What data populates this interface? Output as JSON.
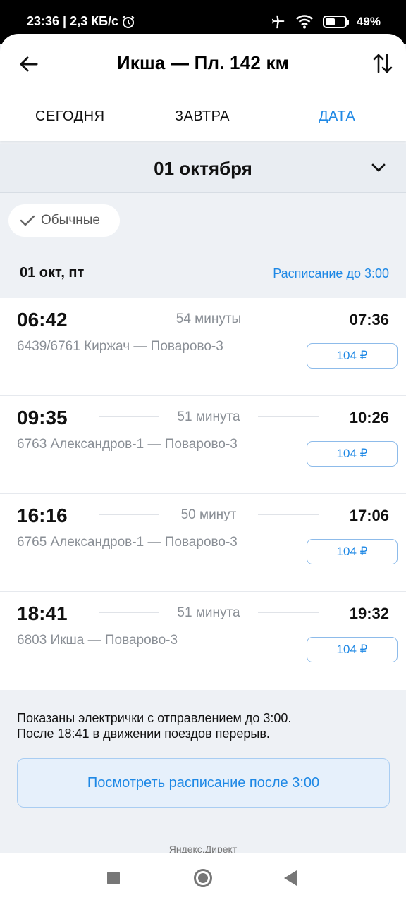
{
  "status_bar": {
    "time_speed": "23:36 | 2,3 КБ/с",
    "battery": "49%",
    "battery_level": 0.49
  },
  "header": {
    "title": "Икша — Пл. 142 км",
    "tabs": [
      {
        "label": "СЕГОДНЯ",
        "active": false
      },
      {
        "label": "ЗАВТРА",
        "active": false
      },
      {
        "label": "ДАТА",
        "active": true
      }
    ]
  },
  "date_selector": {
    "date": "01 октября"
  },
  "filter_chip": {
    "label": "Обычные"
  },
  "day": {
    "heading": "01 окт, пт",
    "schedule_link": "Расписание до 3:00"
  },
  "trips": [
    {
      "departure": "06:42",
      "duration": "54 минуты",
      "arrival": "07:36",
      "route": "6439/6761 Киржач — Поварово-3",
      "price": "104 ₽"
    },
    {
      "departure": "09:35",
      "duration": "51 минута",
      "arrival": "10:26",
      "route": "6763 Александров-1 — Поварово-3",
      "price": "104 ₽"
    },
    {
      "departure": "16:16",
      "duration": "50 минут",
      "arrival": "17:06",
      "route": "6765 Александров-1 — Поварово-3",
      "price": "104 ₽"
    },
    {
      "departure": "18:41",
      "duration": "51 минута",
      "arrival": "19:32",
      "route": "6803 Икша — Поварово-3",
      "price": "104 ₽"
    }
  ],
  "notice": {
    "line1": "Показаны электрички с отправлением до 3:00.",
    "line2": "После 18:41 в движении поездов перерыв."
  },
  "after_button": {
    "label": "Посмотреть расписание после 3:00"
  },
  "ad": {
    "label": "Яндекс.Директ"
  },
  "colors": {
    "accent": "#1e88e5",
    "background": "#eef1f5"
  }
}
